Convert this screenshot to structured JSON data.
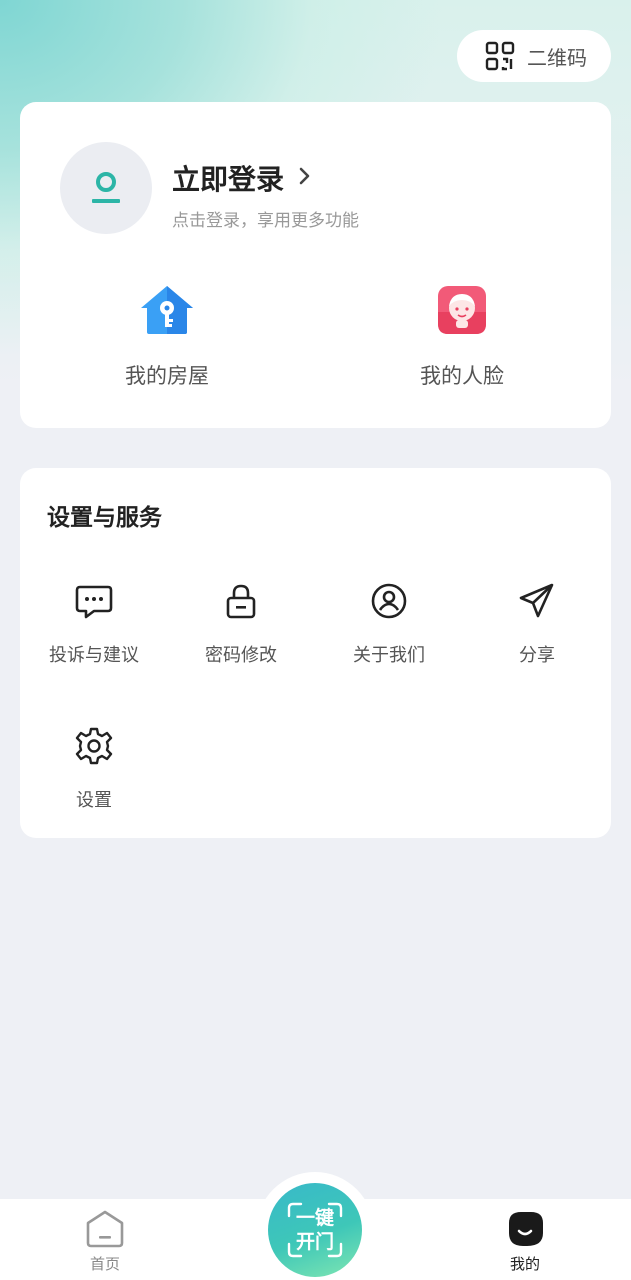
{
  "header": {
    "qr_label": "二维码"
  },
  "profile": {
    "login_title": "立即登录",
    "login_subtitle": "点击登录，享用更多功能",
    "quick_items": [
      {
        "label": "我的房屋",
        "icon": "house-key-icon"
      },
      {
        "label": "我的人脸",
        "icon": "face-icon"
      }
    ]
  },
  "settings": {
    "title": "设置与服务",
    "items": [
      {
        "label": "投诉与建议",
        "icon": "message-dots-icon"
      },
      {
        "label": "密码修改",
        "icon": "lock-icon"
      },
      {
        "label": "关于我们",
        "icon": "user-circle-icon"
      },
      {
        "label": "分享",
        "icon": "paper-plane-icon"
      },
      {
        "label": "设置",
        "icon": "gear-icon"
      }
    ]
  },
  "tabbar": {
    "home_label": "首页",
    "open_line1": "一键",
    "open_line2": "开门",
    "mine_label": "我的"
  },
  "colors": {
    "accent": "#3ec7b8",
    "house_icon": "#2f8ff0",
    "face_icon": "#f0506e"
  }
}
